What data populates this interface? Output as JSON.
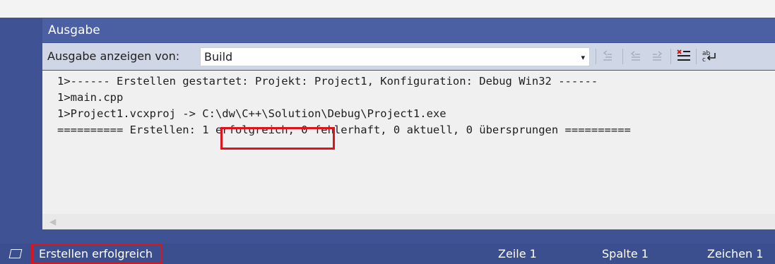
{
  "panel": {
    "title": "Ausgabe"
  },
  "toolbar": {
    "show_output_label": "Ausgabe anzeigen von:",
    "source_value": "Build",
    "source_arrow": "▾",
    "icons": [
      {
        "name": "go-to-previous-message-icon",
        "glyph": "⇐"
      },
      {
        "name": "go-to-next-message-icon",
        "glyph": "⇐"
      },
      {
        "name": "find-previous-message-icon",
        "glyph": "⇐"
      },
      {
        "name": "clear-all-icon",
        "glyph": "☰"
      },
      {
        "name": "toggle-word-wrap-icon",
        "glyph": "ab"
      }
    ]
  },
  "output": {
    "lines": [
      "1>------ Erstellen gestartet: Projekt: Project1, Konfiguration: Debug Win32 ------",
      "1>main.cpp",
      "1>Project1.vcxproj -> C:\\dw\\C++\\Solution\\Debug\\Project1.exe",
      "========== Erstellen: 1 erfolgreich, 0 fehlerhaft, 0 aktuell, 0 übersprungen =========="
    ]
  },
  "statusbar": {
    "status_text": "Erstellen erfolgreich",
    "line_label": "Zeile 1",
    "column_label": "Spalte 1",
    "char_label": "Zeichen 1"
  },
  "colors": {
    "titlebar": "#4a60a3",
    "statusbar": "#3b4f8f",
    "toolbar": "#cfd6e6",
    "highlight": "#e0131a"
  }
}
